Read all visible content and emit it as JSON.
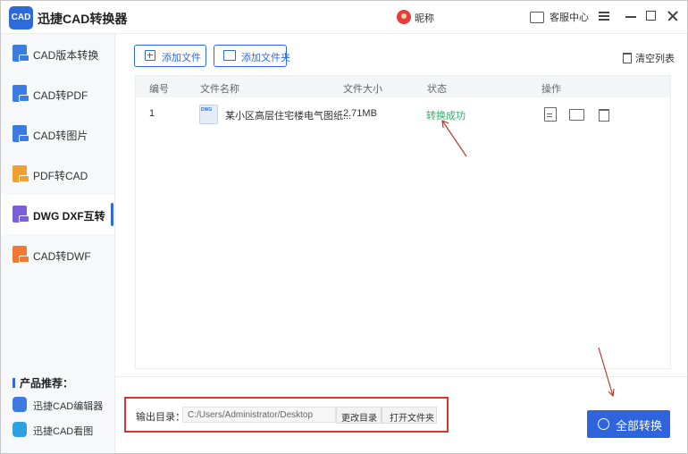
{
  "app": {
    "logo_text": "CAD",
    "title": "迅捷CAD转换器"
  },
  "header": {
    "user_name": "昵称",
    "service_label": "客服中心"
  },
  "sidebar": {
    "items": [
      {
        "label": "CAD版本转换",
        "icon": "cad-version-icon",
        "color": "#3c7be0"
      },
      {
        "label": "CAD转PDF",
        "icon": "cad-to-pdf-icon",
        "color": "#3c7be0"
      },
      {
        "label": "CAD转图片",
        "icon": "cad-to-image-icon",
        "color": "#3c7be0"
      },
      {
        "label": "PDF转CAD",
        "icon": "pdf-to-cad-icon",
        "color": "#f0a030"
      },
      {
        "label": "DWG DXF互转",
        "icon": "dwg-dxf-icon",
        "color": "#7b5fd6",
        "active": true
      },
      {
        "label": "CAD转DWF",
        "icon": "cad-to-dwf-icon",
        "color": "#f07a32"
      }
    ],
    "products_title": "产品推荐：",
    "products": [
      {
        "label": "迅捷CAD编辑器"
      },
      {
        "label": "迅捷CAD看图"
      }
    ]
  },
  "toolbar": {
    "add_file": "添加文件",
    "add_folder": "添加文件夹",
    "clear_list": "清空列表"
  },
  "table": {
    "columns": [
      "编号",
      "文件名称",
      "文件大小",
      "状态",
      "操作"
    ],
    "rows": [
      {
        "index": "1",
        "filename": "某小区高层住宅楼电气图纸...",
        "size": "2.71MB",
        "status": "转换成功"
      }
    ]
  },
  "output": {
    "label": "输出目录：",
    "path": "C:/Users/Administrator/Desktop",
    "change_dir": "更改目录",
    "open_folder": "打开文件夹"
  },
  "convert_all": "全部转换",
  "colors": {
    "accent": "#2f6bd8",
    "success": "#2cb16c",
    "highlight": "#d9352f"
  }
}
